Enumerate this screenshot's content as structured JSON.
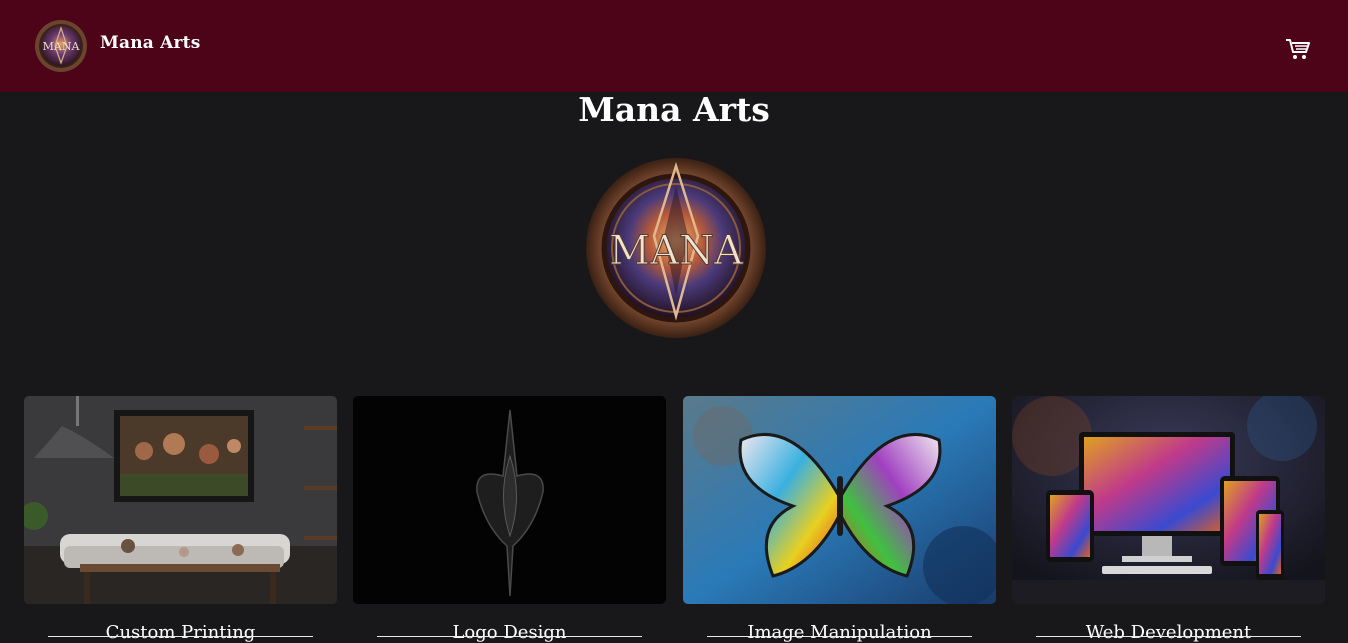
{
  "header": {
    "brand": "Mana Arts",
    "logo_icon": "mana-logo-icon",
    "cart_icon": "cart-icon",
    "background": "#4e0418"
  },
  "hero": {
    "title": "Mana Arts",
    "logo_text": "MANA"
  },
  "services": [
    {
      "title": "Custom Printing",
      "image": "living-room-print-image"
    },
    {
      "title": "Logo Design",
      "image": "logo-emblem-image"
    },
    {
      "title": "Image Manipulation",
      "image": "butterfly-image"
    },
    {
      "title": "Web Development",
      "image": "devices-image"
    }
  ]
}
